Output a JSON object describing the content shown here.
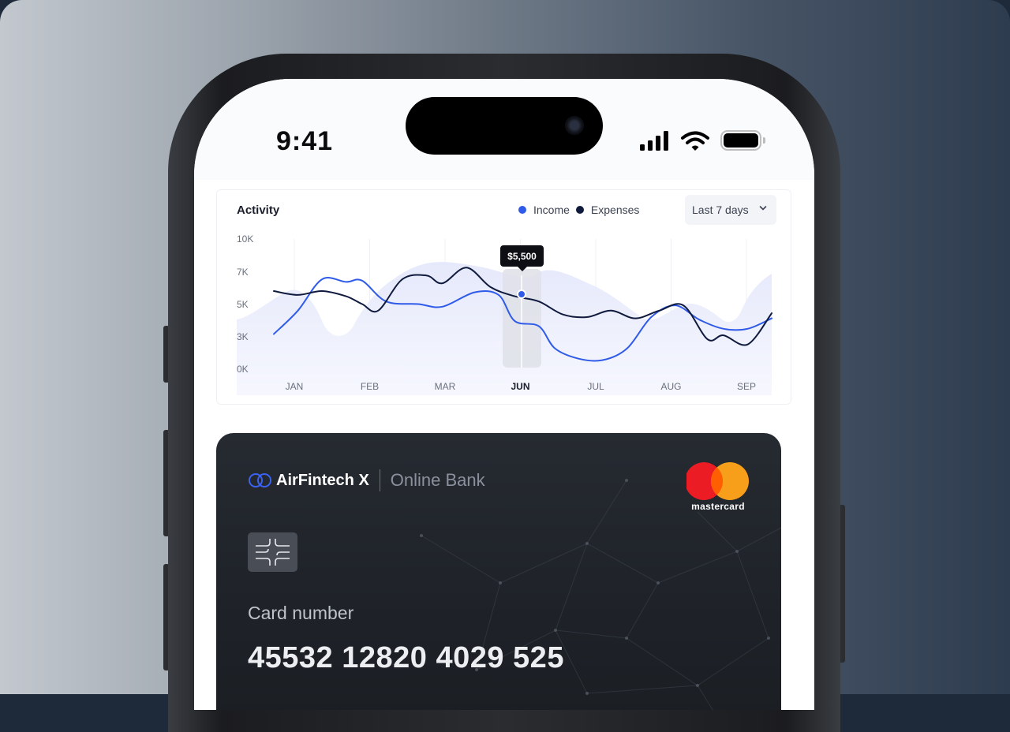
{
  "status_bar": {
    "time": "9:41"
  },
  "activity": {
    "title": "Activity",
    "legend": [
      {
        "label": "Income",
        "color": "#2f5be8"
      },
      {
        "label": "Expenses",
        "color": "#0f1a3d"
      }
    ],
    "period_dropdown": {
      "selected": "Last 7 days"
    },
    "tooltip": "$5,500"
  },
  "chart_data": {
    "type": "line",
    "categories": [
      "JAN",
      "FEB",
      "MAR",
      "JUN",
      "JUL",
      "AUG",
      "SEP"
    ],
    "highlighted_category": "JUN",
    "y_ticks": [
      "10K",
      "7K",
      "5K",
      "3K",
      "0K"
    ],
    "ylim": [
      0,
      10
    ],
    "series": [
      {
        "name": "Income",
        "color": "#2f5be8",
        "x": [
          0,
          0.3,
          0.6,
          0.9,
          1.1,
          1.4,
          1.8,
          2.1,
          2.5,
          2.8,
          3.0,
          3.3,
          3.5,
          3.8,
          4.1,
          4.4,
          4.7,
          5.0,
          5.3,
          5.6,
          5.9,
          6.2
        ],
        "y": [
          2.7,
          4.5,
          6.9,
          6.7,
          6.8,
          5.2,
          5.0,
          4.8,
          5.9,
          5.7,
          3.7,
          3.3,
          1.6,
          0.8,
          0.7,
          1.6,
          4.0,
          4.9,
          3.8,
          3.1,
          3.1,
          3.9
        ]
      },
      {
        "name": "Expenses",
        "color": "#0f1a3d",
        "x": [
          0,
          0.3,
          0.6,
          0.9,
          1.1,
          1.3,
          1.6,
          1.9,
          2.1,
          2.4,
          2.7,
          3.0,
          3.3,
          3.6,
          3.9,
          4.2,
          4.5,
          4.8,
          5.1,
          5.4,
          5.6,
          5.9,
          6.2
        ],
        "y": [
          6.0,
          5.7,
          6.0,
          5.6,
          5.0,
          4.5,
          6.9,
          7.2,
          6.6,
          7.8,
          6.3,
          5.6,
          5.2,
          4.2,
          4.0,
          4.5,
          3.9,
          4.5,
          4.9,
          2.3,
          2.6,
          1.9,
          4.3
        ]
      }
    ]
  },
  "card": {
    "brand": "AirFintech X",
    "subtitle": "Online Bank",
    "network": "mastercard",
    "number_label": "Card number",
    "number": "45532 12820 4029 525"
  }
}
